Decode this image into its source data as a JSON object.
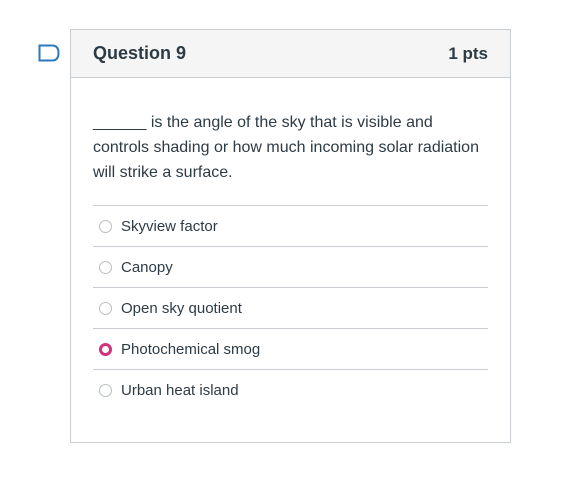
{
  "question": {
    "title": "Question 9",
    "points": "1 pts",
    "text": "______ is the angle of the sky that is visible and controls shading or how much incoming solar radiation will strike a surface.",
    "answers": [
      {
        "label": "Skyview factor",
        "selected": false
      },
      {
        "label": "Canopy",
        "selected": false
      },
      {
        "label": "Open sky quotient",
        "selected": false
      },
      {
        "label": "Photochemical smog",
        "selected": true
      },
      {
        "label": "Urban heat island",
        "selected": false
      }
    ]
  },
  "colors": {
    "selected_radio": "#d2327b",
    "flag_outline": "#2b7abc",
    "header_bg": "#f5f5f5",
    "border": "#c7cdd1"
  },
  "icons": {
    "flag": "bookmark-flag-icon"
  }
}
